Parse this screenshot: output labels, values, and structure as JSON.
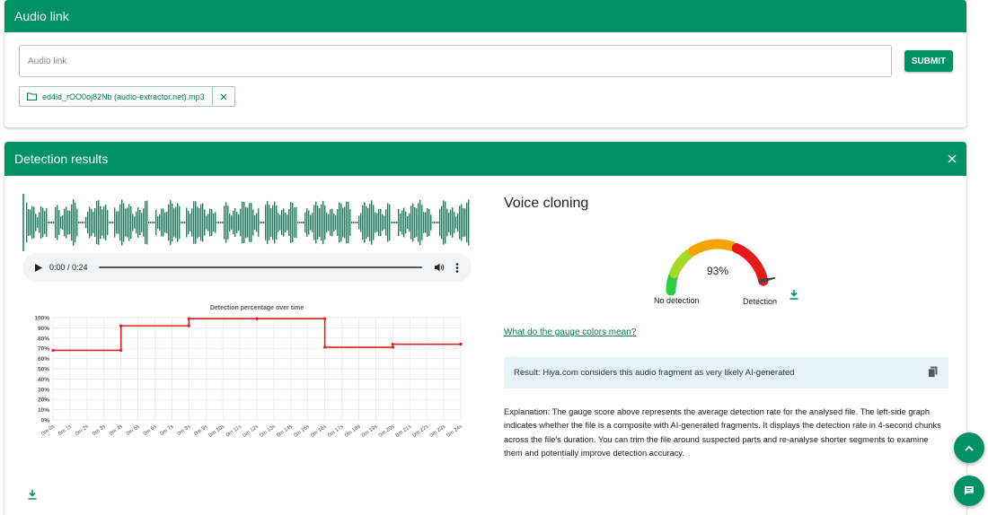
{
  "audio_card": {
    "title": "Audio link",
    "input_placeholder": "Audio link",
    "input_value": "",
    "submit_label": "SUBMIT",
    "file_name": "ed4ld_rOO0oj82Nb (audio-extractor.net).mp3"
  },
  "results_card": {
    "title": "Detection results",
    "player": {
      "time": "0:00 / 0:24"
    },
    "voice_cloning_title": "Voice cloning",
    "gauge": {
      "value_label": "93%",
      "value": 93,
      "label_left": "No detection",
      "label_right": "Detection"
    },
    "gauge_link": "What do the gauge colors mean?",
    "result_text": "Result: Hiya.com considers this audio fragment as very likely AI-generated",
    "explanation": "Explanation: The gauge score above represents the average detection rate for the analysed file. The left-side graph indicates whether the file is a composite with AI-generated fragments. It displays the detection rate in 4-second chunks across the file's duration. You can trim the file around suspected parts and re-analyse shorter segments to examine them and potentially improve detection accuracy."
  },
  "colors": {
    "brand": "#009265",
    "chart_line": "#e02020",
    "result_bg": "#e6f4fa"
  },
  "icons": {
    "file": "folder-icon",
    "chip_close": "close-icon",
    "header_close": "close-icon",
    "play": "play-icon",
    "volume": "volume-icon",
    "more": "more-vert-icon",
    "download": "download-icon",
    "copy": "copy-icon",
    "scroll_up": "chevron-up-icon",
    "chat": "chat-icon"
  },
  "chart_data": {
    "type": "line",
    "title": "Detection percentage over time",
    "xlabel": "",
    "ylabel": "",
    "x_ticks": [
      "0m 0s",
      "0m 1s",
      "0m 2s",
      "0m 3s",
      "0m 4s",
      "0m 5s",
      "0m 6s",
      "0m 7s",
      "0m 8s",
      "0m 9s",
      "0m 10s",
      "0m 11s",
      "0m 12s",
      "0m 13s",
      "0m 14s",
      "0m 15s",
      "0m 16s",
      "0m 17s",
      "0m 18s",
      "0m 19s",
      "0m 20s",
      "0m 21s",
      "0m 22s",
      "0m 23s",
      "0m 24s"
    ],
    "y_ticks": [
      "0%",
      "10%",
      "20%",
      "30%",
      "40%",
      "50%",
      "60%",
      "70%",
      "80%",
      "90%",
      "100%"
    ],
    "ylim": [
      0,
      100
    ],
    "xlim": [
      0,
      24
    ],
    "grid": true,
    "step": true,
    "series": [
      {
        "x": [
          0,
          4,
          8,
          12,
          16,
          20,
          24
        ],
        "y": [
          68,
          92,
          99,
          99,
          71,
          74,
          74
        ]
      }
    ]
  }
}
